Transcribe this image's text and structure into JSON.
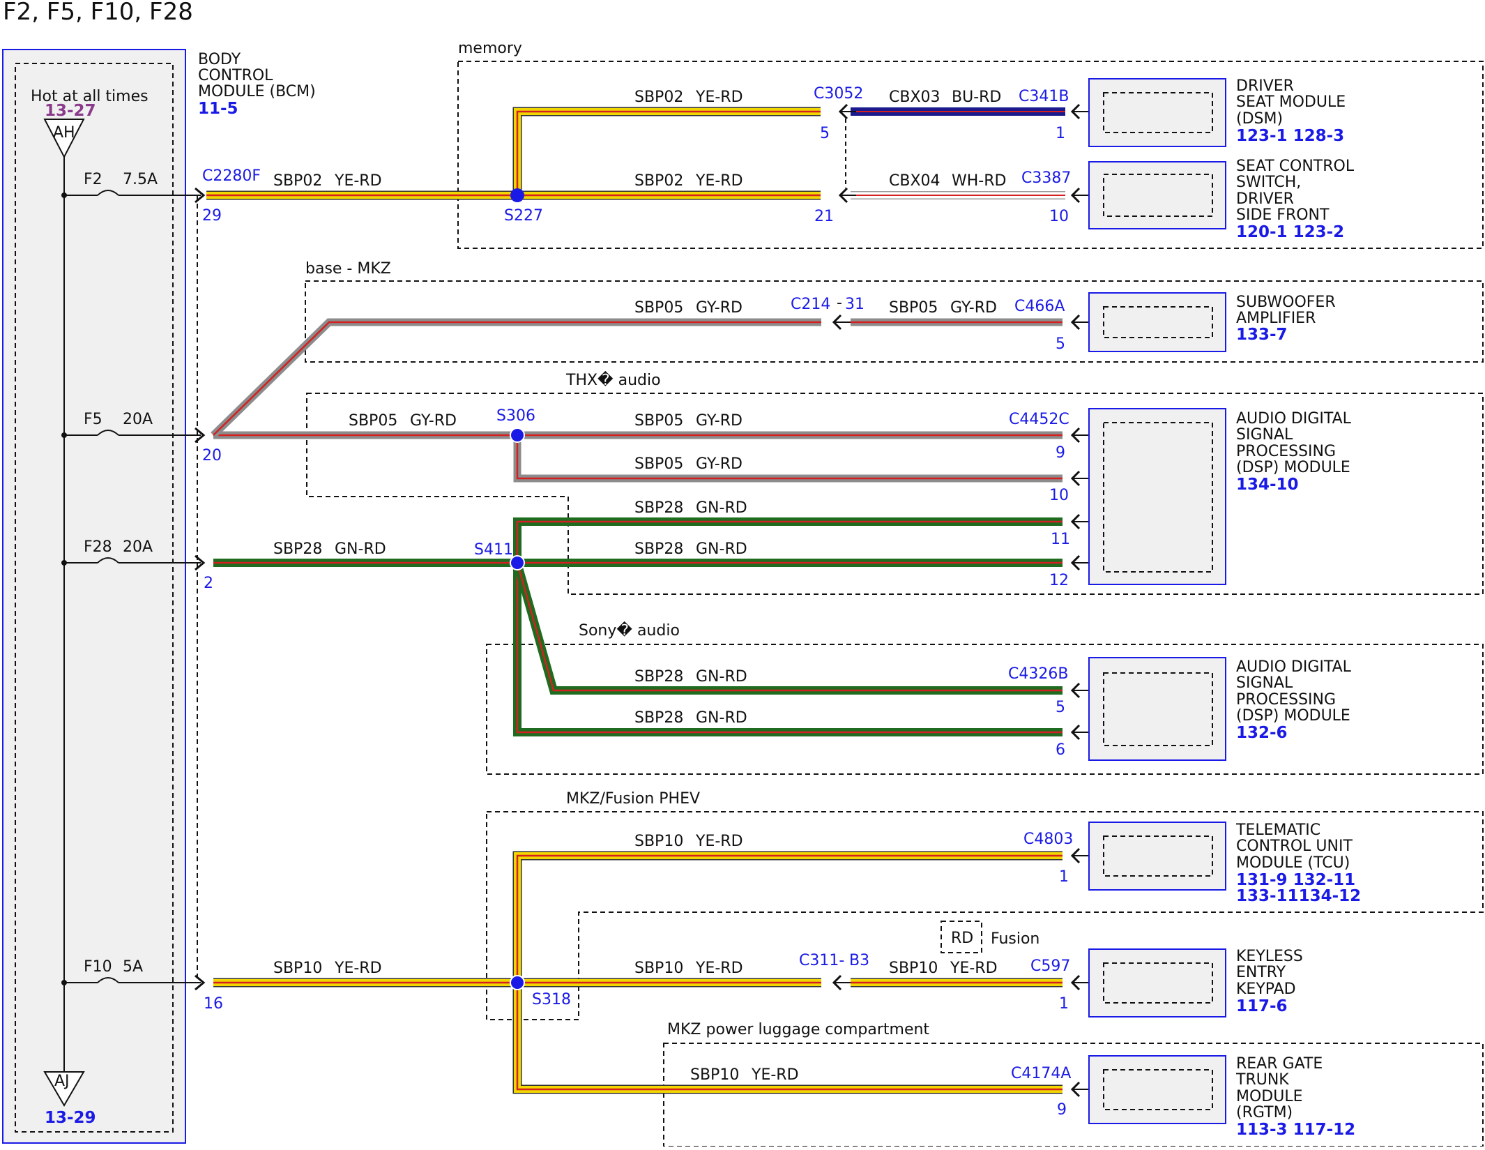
{
  "title": "F2, F5, F10, F28",
  "bcm": {
    "l1": "BODY",
    "l2": "CONTROL",
    "l3": "MODULE (BCM)",
    "ref": "11-5"
  },
  "hot": {
    "label": "Hot at all times",
    "ref": "13-27",
    "tri": "AH"
  },
  "ground": {
    "tri": "AJ",
    "ref": "13-29"
  },
  "fuses": [
    {
      "name": "F2",
      "amp": "7.5A"
    },
    {
      "name": "F5",
      "amp": "20A"
    },
    {
      "name": "F28",
      "amp": "20A"
    },
    {
      "name": "F10",
      "amp": "5A"
    }
  ],
  "groups": {
    "memory": "memory",
    "base": "base - MKZ",
    "thx": "THX� audio",
    "sony": "Sony� audio",
    "phev": "MKZ/Fusion PHEV",
    "lugg": "MKZ power luggage compartment",
    "fusion": "Fusion",
    "rd": "RD"
  },
  "connectors": {
    "c2280f": "C2280F",
    "c3052": "C3052",
    "c341b": "C341B",
    "c3387": "C3387",
    "c214": "C214",
    "c214pin": "31",
    "c466a": "C466A",
    "c4452c": "C4452C",
    "c4326b": "C4326B",
    "c4803": "C4803",
    "c311": "C311-",
    "c311pin": "B3",
    "c597": "C597",
    "c4174a": "C4174A"
  },
  "splices": {
    "s227": "S227",
    "s306": "S306",
    "s411": "S411",
    "s318": "S318"
  },
  "pins": {
    "p29": "29",
    "p20": "20",
    "p2": "2",
    "p16": "16",
    "p5a": "5",
    "p1a": "1",
    "p21": "21",
    "p10a": "10",
    "p5b": "5",
    "p9a": "9",
    "p10b": "10",
    "p11": "11",
    "p12": "12",
    "p5c": "5",
    "p6": "6",
    "p1b": "1",
    "p1c": "1",
    "p9b": "9"
  },
  "wires": {
    "sbp02": "SBP02",
    "yerd": "YE-RD",
    "sbp05": "SBP05",
    "gyrd": "GY-RD",
    "sbp28": "SBP28",
    "gnrd": "GN-RD",
    "sbp10": "SBP10",
    "cbx03": "CBX03",
    "burd": "BU-RD",
    "cbx04": "CBX04",
    "whrd": "WH-RD"
  },
  "modules": [
    {
      "lines": [
        "DRIVER",
        "SEAT MODULE",
        "(DSM)"
      ],
      "ref": "123-1 128-3"
    },
    {
      "lines": [
        "SEAT CONTROL",
        "SWITCH,",
        "DRIVER",
        "SIDE FRONT"
      ],
      "ref": "120-1 123-2"
    },
    {
      "lines": [
        "SUBWOOFER",
        "AMPLIFIER"
      ],
      "ref": "133-7"
    },
    {
      "lines": [
        "AUDIO DIGITAL",
        "SIGNAL",
        "PROCESSING",
        "(DSP) MODULE"
      ],
      "ref": "134-10"
    },
    {
      "lines": [
        "AUDIO DIGITAL",
        "SIGNAL",
        "PROCESSING",
        "(DSP) MODULE"
      ],
      "ref": "132-6"
    },
    {
      "lines": [
        "TELEMATIC",
        "CONTROL UNIT",
        "MODULE (TCU)"
      ],
      "ref": "131-9  132-11",
      "ref2": "133-11134-12"
    },
    {
      "lines": [
        "KEYLESS",
        "ENTRY",
        "KEYPAD"
      ],
      "ref": "117-6"
    },
    {
      "lines": [
        "REAR GATE",
        "TRUNK",
        "MODULE",
        "(RGTM)"
      ],
      "ref": "113-3  117-12"
    }
  ],
  "colors": {
    "yellow": "#f2d600",
    "red": "#d42020",
    "gray": "#8c8c8c",
    "green": "#1f6b1f",
    "blue": "#1a1ae6",
    "darkblue": "#1a1a8c",
    "box": "#f0f0f0"
  }
}
